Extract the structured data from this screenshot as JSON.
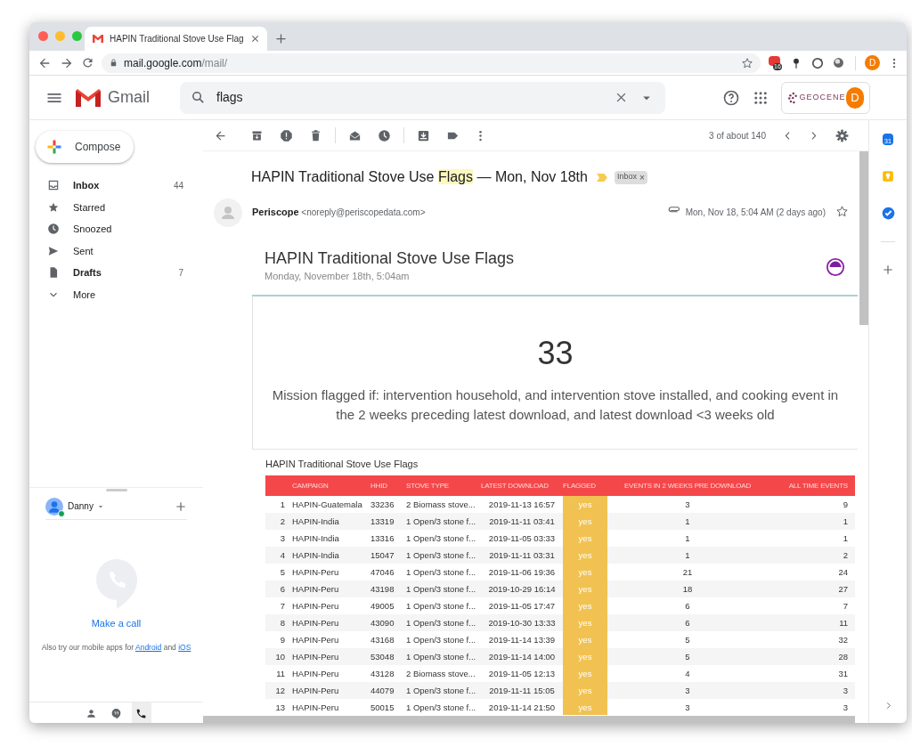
{
  "browser": {
    "tab_title": "HAPIN Traditional Stove Use Flag",
    "url_host": "mail.google.com",
    "url_path": "/mail/",
    "extension_badge": "16",
    "profile_initial": "D"
  },
  "header": {
    "app_name": "Gmail",
    "search_value": "flags",
    "account_initial": "D",
    "org_name": "GEOCENE"
  },
  "sidebar": {
    "compose": "Compose",
    "items": [
      {
        "label": "Inbox",
        "count": "44",
        "unread": true
      },
      {
        "label": "Starred",
        "unread": false
      },
      {
        "label": "Snoozed",
        "unread": false
      },
      {
        "label": "Sent",
        "unread": false
      },
      {
        "label": "Drafts",
        "count": "7",
        "unread": true
      },
      {
        "label": "More",
        "unread": false
      }
    ]
  },
  "hangouts": {
    "user": "Danny",
    "online": true,
    "call_label": "Make a call",
    "hint": "Also try our mobile apps for",
    "link_1": "Android",
    "joiner": "and",
    "link_2": "iOS",
    "tabs": [
      {
        "selected": false
      },
      {
        "selected": false
      },
      {
        "selected": true
      }
    ]
  },
  "toolbar": {
    "pagination": "3 of about 140"
  },
  "message": {
    "subject": [
      {
        "text": "HAPIN Traditional Stove Use ",
        "highlight": false
      },
      {
        "text": "Flags",
        "highlight": true
      },
      {
        "text": " — Mon, Nov 18th",
        "highlight": false
      }
    ],
    "label": "Inbox",
    "label_close": "×",
    "sender_name": "Periscope",
    "sender_email": "<noreply@periscopedata.com>",
    "date": "Mon, Nov 18, 5:04 AM (2 days ago)",
    "has_attachment": true
  },
  "report": {
    "title": "HAPIN Traditional Stove Use Flags",
    "subtitle": "Monday, November 18th, 5:04am",
    "big_number": "33",
    "description": "Mission flagged if: intervention household, and intervention stove installed, and cooking event in the 2 weeks preceding latest download, and latest download <3 weeks old",
    "table_title": "HAPIN Traditional Stove Use Flags",
    "columns": [
      {
        "highlighted": false
      },
      {
        "label": "CAMPAIGN",
        "highlighted": false
      },
      {
        "label": "HHID",
        "highlighted": false
      },
      {
        "label": "STOVE TYPE",
        "highlighted": false
      },
      {
        "label": "LATEST DOWNLOAD",
        "highlighted": false
      },
      {
        "label": "FLAGGED",
        "highlighted": true
      },
      {
        "label": "EVENTS IN 2 WEEKS PRE DOWNLOAD",
        "highlighted": false
      },
      {
        "label": "ALL TIME EVENTS",
        "highlighted": false
      }
    ],
    "rows": [
      [
        "1",
        "HAPIN-Guatemala",
        "33236",
        "2 Biomass stove...",
        "2019-11-13 16:57",
        "yes",
        "3",
        "9"
      ],
      [
        "2",
        "HAPIN-India",
        "13319",
        "1 Open/3 stone f...",
        "2019-11-11 03:41",
        "yes",
        "1",
        "1"
      ],
      [
        "3",
        "HAPIN-India",
        "13316",
        "1 Open/3 stone f...",
        "2019-11-05 03:33",
        "yes",
        "1",
        "1"
      ],
      [
        "4",
        "HAPIN-India",
        "15047",
        "1 Open/3 stone f...",
        "2019-11-11 03:31",
        "yes",
        "1",
        "2"
      ],
      [
        "5",
        "HAPIN-Peru",
        "47046",
        "1 Open/3 stone f...",
        "2019-11-06 19:36",
        "yes",
        "21",
        "24"
      ],
      [
        "6",
        "HAPIN-Peru",
        "43198",
        "1 Open/3 stone f...",
        "2019-10-29 16:14",
        "yes",
        "18",
        "27"
      ],
      [
        "7",
        "HAPIN-Peru",
        "49005",
        "1 Open/3 stone f...",
        "2019-11-05 17:47",
        "yes",
        "6",
        "7"
      ],
      [
        "8",
        "HAPIN-Peru",
        "43090",
        "1 Open/3 stone f...",
        "2019-10-30 13:33",
        "yes",
        "6",
        "11"
      ],
      [
        "9",
        "HAPIN-Peru",
        "43168",
        "1 Open/3 stone f...",
        "2019-11-14 13:39",
        "yes",
        "5",
        "32"
      ],
      [
        "10",
        "HAPIN-Peru",
        "53048",
        "1 Open/3 stone f...",
        "2019-11-14 14:00",
        "yes",
        "5",
        "28"
      ],
      [
        "11",
        "HAPIN-Peru",
        "43128",
        "2 Biomass stove...",
        "2019-11-05 12:13",
        "yes",
        "4",
        "31"
      ],
      [
        "12",
        "HAPIN-Peru",
        "44079",
        "1 Open/3 stone f...",
        "2019-11-11 15:05",
        "yes",
        "3",
        "3"
      ],
      [
        "13",
        "HAPIN-Peru",
        "50015",
        "1 Open/3 stone f...",
        "2019-11-14 21:50",
        "yes",
        "3",
        "3"
      ]
    ]
  },
  "side_panel": {
    "calendar_day": "31"
  }
}
